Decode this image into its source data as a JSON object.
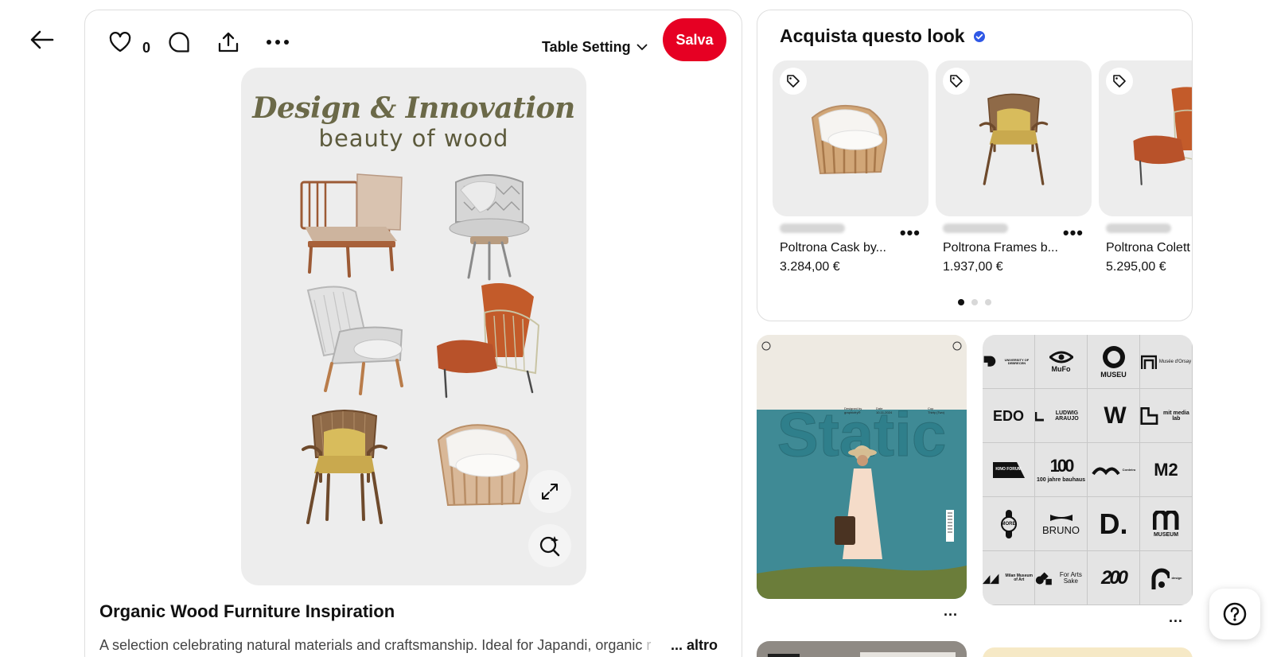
{
  "nav": {
    "back_icon": "arrow-left-icon"
  },
  "toolbar": {
    "like_count": "0",
    "board_name": "Table Setting",
    "save_label": "Salva",
    "icons": [
      "heart-icon",
      "comment-icon",
      "share-icon",
      "more-icon",
      "chevron-down-icon"
    ]
  },
  "pin": {
    "image_title": "Design & Innovation",
    "image_subtitle": "beauty of wood",
    "title": "Organic Wood Furniture Inspiration",
    "description": "A selection celebrating natural materials and craftsmanship. Ideal for Japandi, organic",
    "description_fade": " r",
    "more_label": "... altro"
  },
  "shop": {
    "title": "Acquista questo look",
    "products": [
      {
        "name": "Poltrona Cask by...",
        "price": "3.284,00 €"
      },
      {
        "name": "Poltrona Frames b...",
        "price": "1.937,00 €"
      },
      {
        "name": "Poltrona Colett",
        "price": "5.295,00 €"
      }
    ],
    "pagination": {
      "count": 3,
      "active": 0
    }
  },
  "related": {
    "magazine_title": "Static",
    "magazine_meta": [
      "Designed by",
      "graphicfry®",
      "Date",
      "10-11-2024",
      "Cop",
      "Thirty (Two)"
    ],
    "logos": [
      [
        "UNIVERSITY OF DEBRECEN",
        "MuFo",
        "MUSEU",
        "Musée d'Orsay"
      ],
      [
        "EDO",
        "LUDWIG ARAUJO",
        "W",
        "mit media lab"
      ],
      [
        "KINO FORUM",
        "100 jahre bauhaus",
        "Cordeiro",
        "M2"
      ],
      [
        "MORE",
        "BRUNO",
        "D.",
        "MUSEUM"
      ],
      [
        "Milan Museum of Art",
        "For Arts Sake",
        "200",
        "design"
      ]
    ],
    "more_label": "..."
  },
  "colors": {
    "save_red": "#e60023",
    "verified_blue": "#2f58e6",
    "olive_text": "#6b6948"
  },
  "help": {
    "icon": "help-icon"
  }
}
